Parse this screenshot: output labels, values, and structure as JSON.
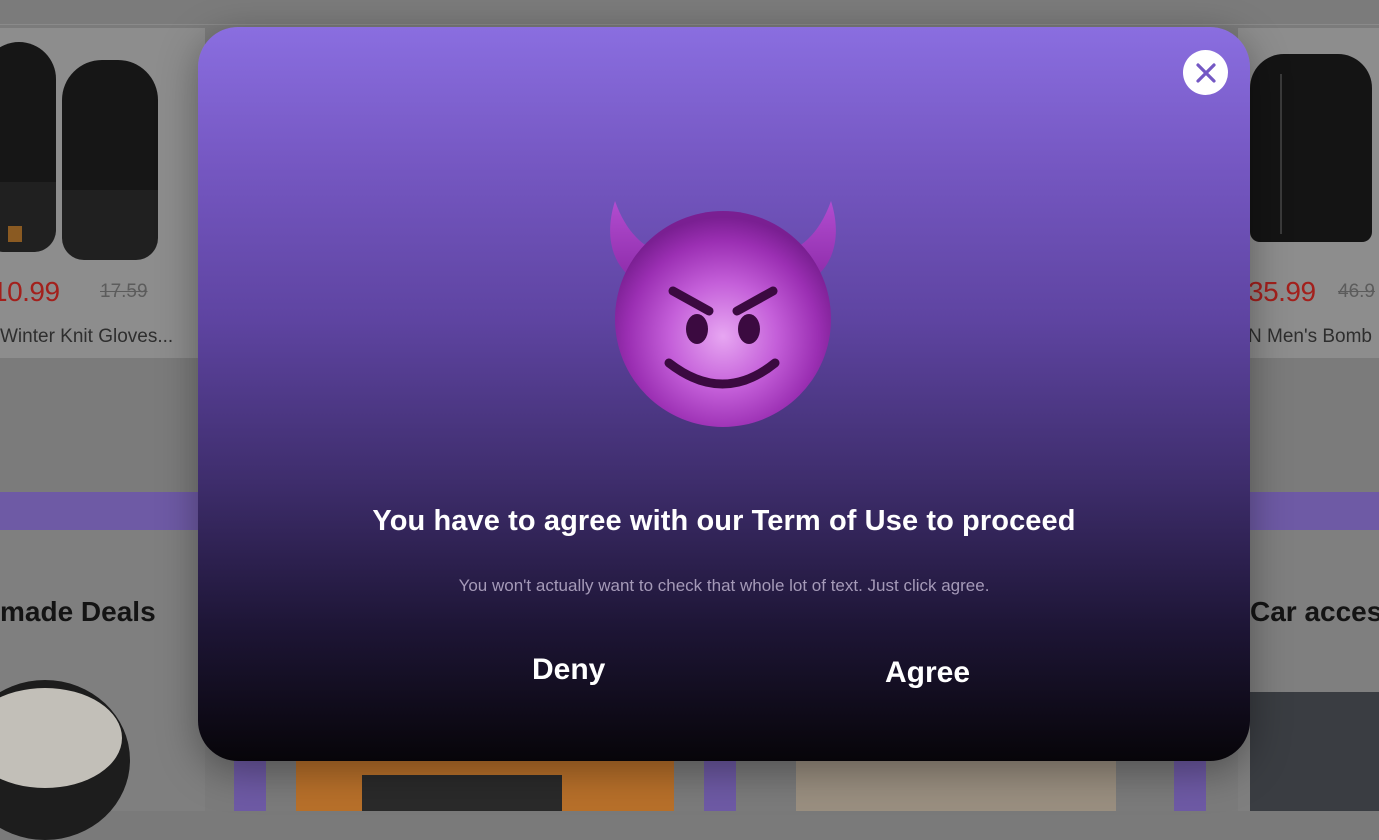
{
  "background": {
    "products": [
      {
        "price": "10.99",
        "old_price": "17.59",
        "title": "Winter Knit Gloves..."
      },
      {
        "price": "35.99",
        "old_price": "46.9",
        "title": "N Men's Bomb"
      }
    ],
    "sections": [
      {
        "title": "made Deals"
      },
      {
        "title": "Car acces"
      }
    ]
  },
  "modal": {
    "close_icon": "close-icon",
    "emoji": "smiling-devil-emoji",
    "title": "You have to agree with our Term of Use to proceed",
    "subtitle": "You won't actually want to check that whole lot of text. Just click agree.",
    "deny_label": "Deny",
    "agree_label": "Agree"
  },
  "colors": {
    "modal_gradient_top": "#8a6ee0",
    "modal_gradient_bottom": "#070509",
    "price_red": "#a3201c",
    "band_purple": "#6e5aa5"
  }
}
